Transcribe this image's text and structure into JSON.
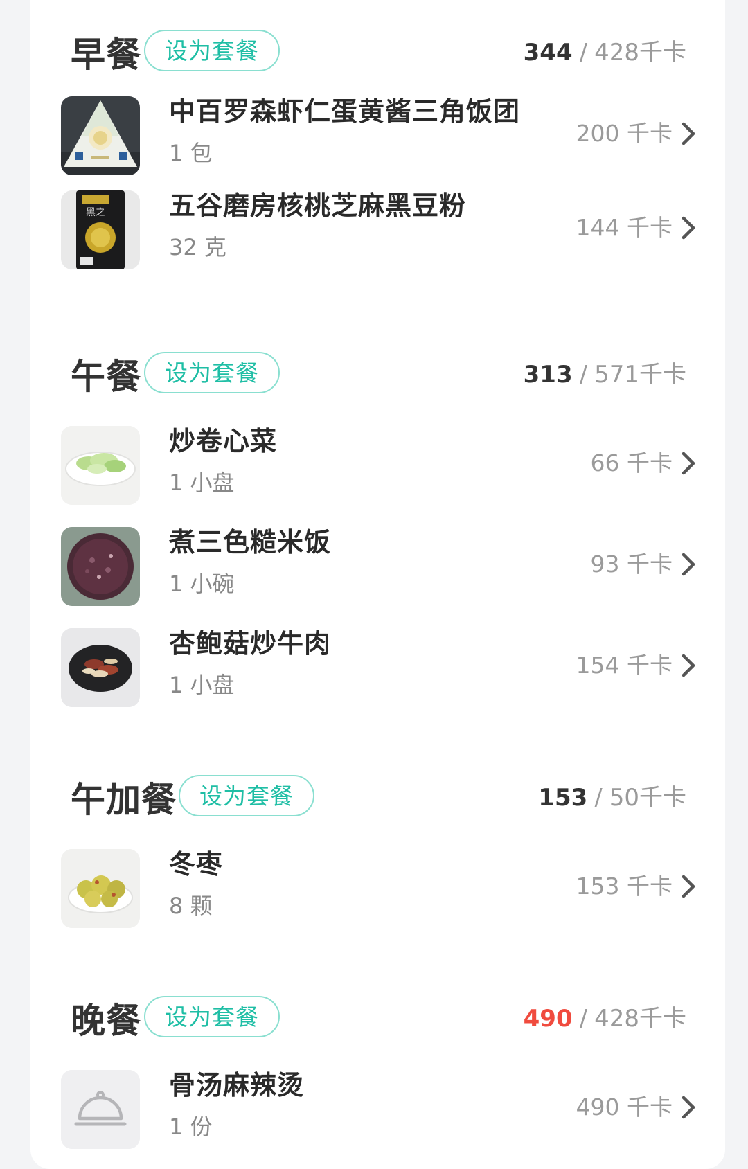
{
  "set_button_label": "设为套餐",
  "meals": [
    {
      "key": "breakfast",
      "title": "早餐",
      "eaten": "344",
      "separator": "/",
      "target": "428千卡",
      "items": [
        {
          "name": "中百罗森虾仁蛋黄酱三角饭团",
          "amount": "1 包",
          "calories": "200 千卡",
          "image": "rice-ball-package"
        },
        {
          "name": "五谷磨房核桃芝麻黑豆粉",
          "amount": "32 克",
          "calories": "144 千卡",
          "image": "black-bean-powder-package"
        }
      ]
    },
    {
      "key": "lunch",
      "title": "午餐",
      "eaten": "313",
      "separator": "/",
      "target": "571千卡",
      "items": [
        {
          "name": "炒卷心菜",
          "amount": "1 小盘",
          "calories": "66 千卡",
          "image": "stir-fried-cabbage"
        },
        {
          "name": "煮三色糙米饭",
          "amount": "1 小碗",
          "calories": "93 千卡",
          "image": "tricolor-brown-rice"
        },
        {
          "name": "杏鲍菇炒牛肉",
          "amount": "1 小盘",
          "calories": "154 千卡",
          "image": "king-oyster-mushroom-beef"
        }
      ]
    },
    {
      "key": "afternoon-snack",
      "title": "午加餐",
      "eaten": "153",
      "separator": "/",
      "target": "50千卡",
      "items": [
        {
          "name": "冬枣",
          "amount": "8 颗",
          "calories": "153 千卡",
          "image": "winter-jujubes"
        }
      ]
    },
    {
      "key": "dinner",
      "title": "晚餐",
      "eaten": "490",
      "eaten_over_target": true,
      "over_color": "#f04b3e",
      "separator": "/",
      "target": "428千卡",
      "items": [
        {
          "name": "骨汤麻辣烫",
          "amount": "1 份",
          "calories": "490 千卡",
          "image": "food-cloche-placeholder-icon"
        }
      ]
    }
  ],
  "colors": {
    "accent": "#1fbea5",
    "accent_border": "#8adfd0",
    "over_target": "#f04b3e",
    "muted_text": "#9a9a9a"
  }
}
